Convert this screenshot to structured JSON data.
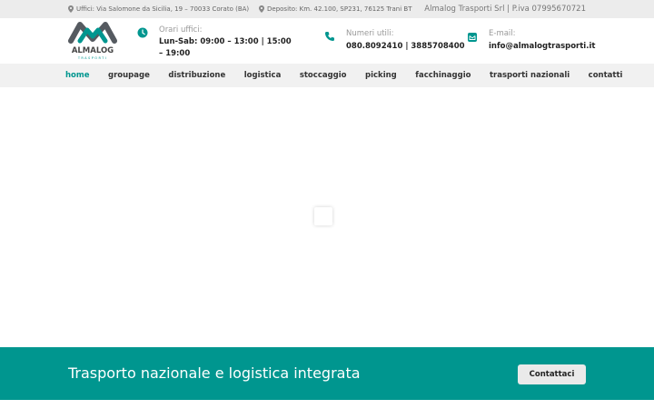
{
  "topbar": {
    "address_office": "Uffici: Via Salomone da Sicilia, 19 – 70033 Corato (BA)",
    "address_depot": "Deposito: Km. 42.100, SP231, 76125 Trani BT",
    "company": "Almalog Trasporti Srl | P.iva 07995670721"
  },
  "logo": {
    "name": "ALMALOG",
    "sub": "TRASPORTI"
  },
  "header": {
    "hours": {
      "label": "Orari uffici:",
      "value": "Lun-Sab: 09:00 – 13:00 | 15:00 – 19:00"
    },
    "phones": {
      "label": "Numeri utili:",
      "value": "080.8092410 | 3885708400"
    },
    "email": {
      "label": "E-mail:",
      "value": "info@almalogtrasporti.it"
    }
  },
  "nav": {
    "items": [
      {
        "label": "home",
        "active": true
      },
      {
        "label": "groupage"
      },
      {
        "label": "distribuzione"
      },
      {
        "label": "logistica"
      },
      {
        "label": "stoccaggio"
      },
      {
        "label": "picking"
      },
      {
        "label": "facchinaggio"
      },
      {
        "label": "trasporti nazionali"
      },
      {
        "label": "contatti"
      }
    ]
  },
  "cta": {
    "title": "Trasporto nazionale e logistica integrata",
    "button": "Contattaci"
  },
  "colors": {
    "accent": "#00968f",
    "logo_dark": "#555a60"
  },
  "icons": {
    "location": "map-pin-icon",
    "hours": "clock-icon",
    "phone": "phone-icon",
    "email": "envelope-icon"
  }
}
